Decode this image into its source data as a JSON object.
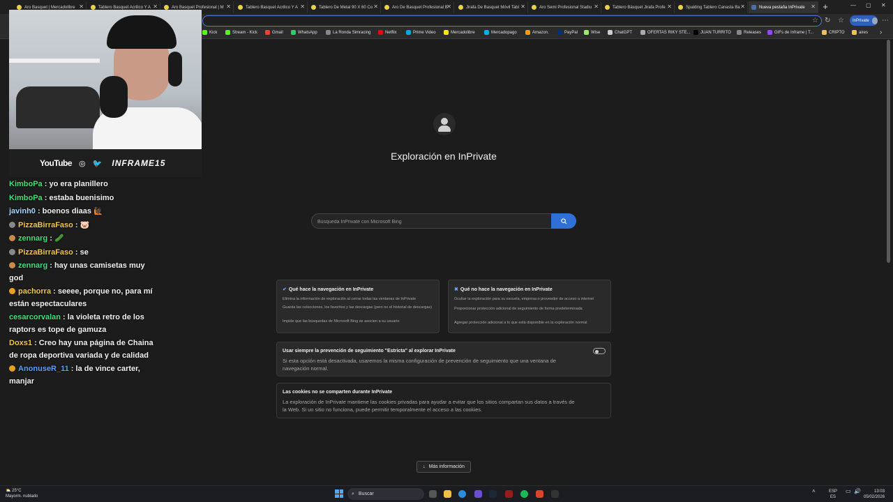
{
  "tabs": [
    {
      "label": "Aro Basquet | Mercadolibre"
    },
    {
      "label": "Tablero Basquet Acrilico Y A"
    },
    {
      "label": "Aro Basquet Profesional | M"
    },
    {
      "label": "Tablero Basquet Acrilico Y A"
    },
    {
      "label": "Tablero De Metal 90 X 60 Co"
    },
    {
      "label": "Aro De Basquet Profesional B"
    },
    {
      "label": "Jirafa De Basquet Móvil Tabl"
    },
    {
      "label": "Aro Semi Profesional Stadiu"
    },
    {
      "label": "Tablero Básquet Jirafa Profe"
    },
    {
      "label": "Spalding Tablero Canasta Ba"
    },
    {
      "label": "Nueva pestaña InPrivate"
    }
  ],
  "browser": {
    "inprivate_label": "InPrivate",
    "tab_close_glyph": "✕",
    "newtab_glyph": "+",
    "icons": [
      "minimize-icon",
      "restore-icon",
      "close-icon",
      "star-icon",
      "refresh-icon",
      "favorites-icon",
      "menu-icon"
    ]
  },
  "favorites": [
    {
      "label": "Kick",
      "color": "#53fc18"
    },
    {
      "label": "Stream - Kick",
      "color": "#53fc18"
    },
    {
      "label": "Gmail",
      "color": "#ea4335"
    },
    {
      "label": "WhatsApp",
      "color": "#25d366"
    },
    {
      "label": "La Ronda Simracing",
      "color": "#888888"
    },
    {
      "label": "Netflix",
      "color": "#e50914"
    },
    {
      "label": "Prime Video",
      "color": "#00a8e1"
    },
    {
      "label": "Mercadolibre",
      "color": "#ffe600"
    },
    {
      "label": "Mercadopago",
      "color": "#00b1ea"
    },
    {
      "label": "Amazon.",
      "color": "#ff9900"
    },
    {
      "label": "PayPal",
      "color": "#003087"
    },
    {
      "label": "Wise",
      "color": "#9fe870"
    },
    {
      "label": "ChatGPT",
      "color": "#cccccc"
    },
    {
      "label": "OFERTAS RIKY STE...",
      "color": "#aaaaaa"
    },
    {
      "label": "JUAN TURRITO",
      "color": "#000000"
    },
    {
      "label": "Releases",
      "color": "#888888"
    },
    {
      "label": "GIFs de Inframe | T...",
      "color": "#9146ff"
    },
    {
      "label": "CRIPTO",
      "color": "#e8c15a"
    },
    {
      "label": "aires",
      "color": "#e8c15a"
    }
  ],
  "overlay": {
    "youtube_label": "YouTube",
    "handle": "INFRAME15"
  },
  "chat": [
    {
      "user": "KimboPa",
      "color": "#3ee07a",
      "badge": "",
      "text": " : yo era planillero"
    },
    {
      "user": "KimboPa",
      "color": "#3ee07a",
      "badge": "",
      "text": " : estaba buenisimo"
    },
    {
      "user": "javinh0",
      "color": "#a9d6ff",
      "badge": "",
      "text": " : boenos diaas 🙋🏿"
    },
    {
      "user": "PizzaBirraFaso",
      "color": "#f0c84a",
      "badge": "#888888",
      "text": " : 🐷"
    },
    {
      "user": "zennarg",
      "color": "#3ee07a",
      "badge": "#c98a4a",
      "text": " : 🥒"
    },
    {
      "user": "PizzaBirraFaso",
      "color": "#f0c84a",
      "badge": "#888888",
      "text": " : se"
    },
    {
      "user": "zennarg",
      "color": "#3ee07a",
      "badge": "#c98a4a",
      "text": " : hay unas camisetas muy god"
    },
    {
      "user": "pachorra",
      "color": "#f0c84a",
      "badge": "#e8a020",
      "text": " : seeee, porque no, para mí están espectaculares"
    },
    {
      "user": "cesarcorvalan",
      "color": "#3ee07a",
      "badge": "",
      "text": " : la violeta retro de los raptors es tope de gamuza"
    },
    {
      "user": "Doxs1",
      "color": "#f0c84a",
      "badge": "",
      "text": " : Creo hay una página de Chaina de ropa deportiva variada y de calidad"
    },
    {
      "user": "AnonuseR_11",
      "color": "#5aa0ff",
      "badge": "#e8a020",
      "text": " : la de vince carter, manjar"
    }
  ],
  "page": {
    "title": "Exploración en InPrivate",
    "search_placeholder": "Búsqueda InPrivate con Microsoft Bing",
    "does_title": "Qué hace la navegación en InPrivate",
    "does_items": [
      "Elimina la información de exploración al cerrar todas las ventanas de InPrivate",
      "Guarda las colecciones, los favoritos y las descargas (pero no el historial de descargas)",
      "Impide que las búsquedas de Microsoft Bing se asocien a su usuario"
    ],
    "doesnt_title": "Qué no hace la navegación en InPrivate",
    "doesnt_items": [
      "Ocultar la exploración para su escuela, empresa o proveedor de acceso a internet",
      "Proporcionar protección adicional de seguimiento de forma predeterminada",
      "Agregar protección adicional a lo que está disponible en la exploración normal"
    ],
    "strict_title": "Usar siempre la prevención de seguimiento \"Estricta\" al explorar InPrivate",
    "strict_desc": "Si esta opción está desactivada, usaremos la misma configuración de prevención de seguimiento que una ventana de navegación normal.",
    "strict_enabled": false,
    "cookies_title": "Las cookies no se comparten durante InPrivate",
    "cookies_desc": "La exploración de InPrivate mantiene las cookies privadas para ayudar a evitar que los sitios compartan sus datos a través de la Web. Si un sitio no funciona, puede permitir temporalmente el acceso a las cookies.",
    "more_info": "Más información"
  },
  "taskbar": {
    "temp": "25°C",
    "weather": "Mayorm. nublado",
    "search_label": "Buscar",
    "lang1": "ESP",
    "lang2": "ES",
    "time": "13:03",
    "date": "05/02/2026"
  }
}
